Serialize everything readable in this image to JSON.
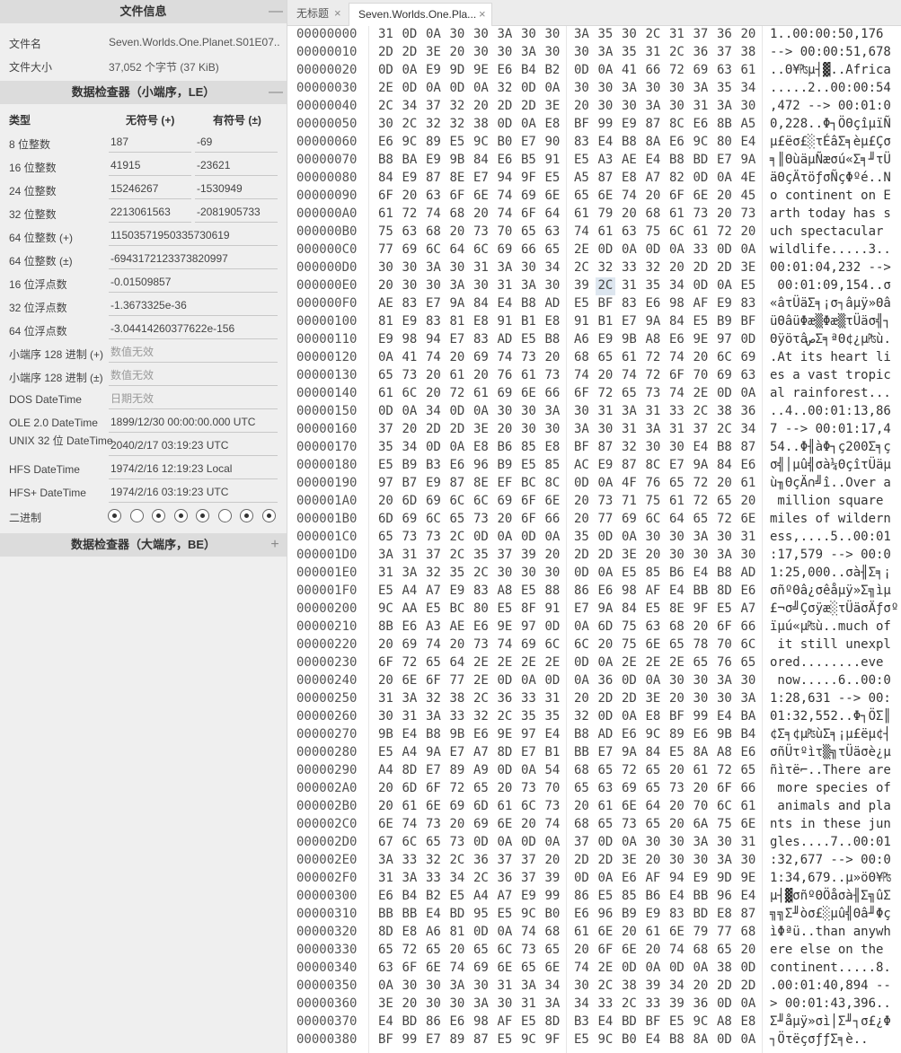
{
  "file_info": {
    "title": "文件信息",
    "toggle": "—",
    "rows": [
      {
        "label": "文件名",
        "value": "Seven.Worlds.One.Planet.S01E07..."
      },
      {
        "label": "文件大小",
        "value": "37,052 个字节 (37 KiB)"
      }
    ]
  },
  "inspector_le": {
    "title": "数据检查器（小端序，LE）",
    "toggle": "—",
    "col_type": "类型",
    "col_unsigned": "无符号 (+)",
    "col_signed": "有符号 (±)",
    "rows_pair": [
      {
        "label": "8 位整数",
        "u": "187",
        "s": "-69"
      },
      {
        "label": "16 位整数",
        "u": "41915",
        "s": "-23621"
      },
      {
        "label": "24 位整数",
        "u": "15246267",
        "s": "-1530949"
      },
      {
        "label": "32 位整数",
        "u": "2213061563",
        "s": "-2081905733"
      }
    ],
    "rows_wide": [
      {
        "label": "64 位整数 (+)",
        "value": "11503571950335730619",
        "invalid": false
      },
      {
        "label": "64 位整数 (±)",
        "value": "-6943172123373820997",
        "invalid": false
      },
      {
        "label": "16 位浮点数",
        "value": "-0.01509857",
        "invalid": false
      },
      {
        "label": "32 位浮点数",
        "value": "-1.3673325e-36",
        "invalid": false
      },
      {
        "label": "64 位浮点数",
        "value": "-3.04414260377622e-156",
        "invalid": false
      },
      {
        "label": "小端序 128 进制 (+)",
        "value": "数值无效",
        "invalid": true
      },
      {
        "label": "小端序 128 进制 (±)",
        "value": "数值无效",
        "invalid": true
      },
      {
        "label": "DOS DateTime",
        "value": "日期无效",
        "invalid": true
      },
      {
        "label": "OLE 2.0 DateTime",
        "value": "1899/12/30 00:00:00.000 UTC",
        "invalid": false
      },
      {
        "label": "UNIX 32 位 DateTime",
        "value": "2040/2/17 03:19:23 UTC",
        "invalid": false
      },
      {
        "label": "HFS DateTime",
        "value": "1974/2/16 12:19:23 Local",
        "invalid": false
      },
      {
        "label": "HFS+ DateTime",
        "value": "1974/2/16 03:19:23 UTC",
        "invalid": false
      }
    ],
    "binary_label": "二进制",
    "binary_bits": [
      1,
      0,
      1,
      1,
      1,
      0,
      1,
      1
    ]
  },
  "inspector_be": {
    "title": "数据检查器（大端序，BE）",
    "toggle": "+"
  },
  "tabs": [
    {
      "label": "无标题",
      "close": "×",
      "active": false
    },
    {
      "label": "Seven.Worlds.One.Pla...",
      "close": "×",
      "active": true
    }
  ],
  "hex_selected": {
    "row": 14,
    "col": 9
  },
  "hex_rows": [
    {
      "off": "00000000",
      "bytes": "31 0D 0A 30 30 3A 30 30 3A 35 30 2C 31 37 36 20",
      "ascii": "1..00:00:50,176 "
    },
    {
      "off": "00000010",
      "bytes": "2D 2D 3E 20 30 30 3A 30 30 3A 35 31 2C 36 37 38",
      "ascii": "--> 00:00:51,678"
    },
    {
      "off": "00000020",
      "bytes": "0D 0A E9 9D 9E E6 B4 B2 0D 0A 41 66 72 69 63 61",
      "ascii": "..Θ¥₧µ┤▓..Africa"
    },
    {
      "off": "00000030",
      "bytes": "2E 0D 0A 0D 0A 32 0D 0A 30 30 3A 30 30 3A 35 34",
      "ascii": ".....2..00:00:54"
    },
    {
      "off": "00000040",
      "bytes": "2C 34 37 32 20 2D 2D 3E 20 30 30 3A 30 31 3A 30",
      "ascii": ",472 --> 00:01:0"
    },
    {
      "off": "00000050",
      "bytes": "30 2C 32 32 38 0D 0A E8 BF 99 E9 87 8C E6 8B A5",
      "ascii": "0,228..Φ┐ÖΘçîµïÑ"
    },
    {
      "off": "00000060",
      "bytes": "E6 9C 89 E5 9C B0 E7 90 83 E4 B8 8A E6 9C 80 E4",
      "ascii": "µ£ëσ£░τÉâΣ╕èµ£Çσ"
    },
    {
      "off": "00000070",
      "bytes": "B8 BA E9 9B 84 E6 B5 91 E5 A3 AE E4 B8 BD E7 9A",
      "ascii": "╕║ΘùäµÑæσú«Σ╕╜τÜ"
    },
    {
      "off": "00000080",
      "bytes": "84 E9 87 8E E7 94 9F E5 A5 87 E8 A7 82 0D 0A 4E",
      "ascii": "äΘçÄτöƒσÑçΦºé..N"
    },
    {
      "off": "00000090",
      "bytes": "6F 20 63 6F 6E 74 69 6E 65 6E 74 20 6F 6E 20 45",
      "ascii": "o continent on E"
    },
    {
      "off": "000000A0",
      "bytes": "61 72 74 68 20 74 6F 64 61 79 20 68 61 73 20 73",
      "ascii": "arth today has s"
    },
    {
      "off": "000000B0",
      "bytes": "75 63 68 20 73 70 65 63 74 61 63 75 6C 61 72 20",
      "ascii": "uch spectacular "
    },
    {
      "off": "000000C0",
      "bytes": "77 69 6C 64 6C 69 66 65 2E 0D 0A 0D 0A 33 0D 0A",
      "ascii": "wildlife.....3.."
    },
    {
      "off": "000000D0",
      "bytes": "30 30 3A 30 31 3A 30 34 2C 32 33 32 20 2D 2D 3E",
      "ascii": "00:01:04,232 -->"
    },
    {
      "off": "000000E0",
      "bytes": "20 30 30 3A 30 31 3A 30 39 2C 31 35 34 0D 0A E5",
      "ascii": " 00:01:09,154..σ"
    },
    {
      "off": "000000F0",
      "bytes": "AE 83 E7 9A 84 E4 B8 AD E5 BF 83 E6 98 AF E9 83",
      "ascii": "«âτÜäΣ╕¡σ┐âµÿ»Θâ"
    },
    {
      "off": "00000100",
      "bytes": "81 E9 83 81 E8 91 B1 E8 91 B1 E7 9A 84 E5 B9 BF",
      "ascii": "üΘâüΦæ▒Φæ▒τÜäσ╣┐"
    },
    {
      "off": "00000110",
      "bytes": "E9 98 94 E7 83 AD E5 B8 A6 E9 9B A8 E6 9E 97 0D",
      "ascii": "ΘÿöτâصΣ╕ªΘ¢¿µ₧ù."
    },
    {
      "off": "00000120",
      "bytes": "0A 41 74 20 69 74 73 20 68 65 61 72 74 20 6C 69",
      "ascii": ".At its heart li"
    },
    {
      "off": "00000130",
      "bytes": "65 73 20 61 20 76 61 73 74 20 74 72 6F 70 69 63",
      "ascii": "es a vast tropic"
    },
    {
      "off": "00000140",
      "bytes": "61 6C 20 72 61 69 6E 66 6F 72 65 73 74 2E 0D 0A",
      "ascii": "al rainforest..."
    },
    {
      "off": "00000150",
      "bytes": "0D 0A 34 0D 0A 30 30 3A 30 31 3A 31 33 2C 38 36",
      "ascii": "..4..00:01:13,86"
    },
    {
      "off": "00000160",
      "bytes": "37 20 2D 2D 3E 20 30 30 3A 30 31 3A 31 37 2C 34",
      "ascii": "7 --> 00:01:17,4"
    },
    {
      "off": "00000170",
      "bytes": "35 34 0D 0A E8 B6 85 E8 BF 87 32 30 30 E4 B8 87",
      "ascii": "54..Φ╢àΦ┐ç200Σ╕ç"
    },
    {
      "off": "00000180",
      "bytes": "E5 B9 B3 E6 96 B9 E5 85 AC E9 87 8C E7 9A 84 E6",
      "ascii": "σ╣│µû╣σà¼ΘçîτÜäµ"
    },
    {
      "off": "00000190",
      "bytes": "97 B7 E9 87 8E EF BC 8C 0D 0A 4F 76 65 72 20 61",
      "ascii": "ù╖ΘçÄ∩╝î..Over a"
    },
    {
      "off": "000001A0",
      "bytes": "20 6D 69 6C 6C 69 6F 6E 20 73 71 75 61 72 65 20",
      "ascii": " million square "
    },
    {
      "off": "000001B0",
      "bytes": "6D 69 6C 65 73 20 6F 66 20 77 69 6C 64 65 72 6E",
      "ascii": "miles of wildern"
    },
    {
      "off": "000001C0",
      "bytes": "65 73 73 2C 0D 0A 0D 0A 35 0D 0A 30 30 3A 30 31",
      "ascii": "ess,....5..00:01"
    },
    {
      "off": "000001D0",
      "bytes": "3A 31 37 2C 35 37 39 20 2D 2D 3E 20 30 30 3A 30",
      "ascii": ":17,579 --> 00:0"
    },
    {
      "off": "000001E0",
      "bytes": "31 3A 32 35 2C 30 30 30 0D 0A E5 85 B6 E4 B8 AD",
      "ascii": "1:25,000..σà╢Σ╕¡"
    },
    {
      "off": "000001F0",
      "bytes": "E5 A4 A7 E9 83 A8 E5 88 86 E6 98 AF E4 BB 8D E6",
      "ascii": "σñºΘâ¿σêåµÿ»Σ╗ìµ"
    },
    {
      "off": "00000200",
      "bytes": "9C AA E5 BC 80 E5 8F 91 E7 9A 84 E5 8E 9F E5 A7",
      "ascii": "£¬σ╝Çσÿæ░τÜäσÄƒσº"
    },
    {
      "off": "00000210",
      "bytes": "8B E6 A3 AE E6 9E 97 0D 0A 6D 75 63 68 20 6F 66",
      "ascii": "ïµú«µ₧ù..much of"
    },
    {
      "off": "00000220",
      "bytes": "20 69 74 20 73 74 69 6C 6C 20 75 6E 65 78 70 6C",
      "ascii": " it still unexpl"
    },
    {
      "off": "00000230",
      "bytes": "6F 72 65 64 2E 2E 2E 2E 0D 0A 2E 2E 2E 65 76 65",
      "ascii": "ored........eve"
    },
    {
      "off": "00000240",
      "bytes": "20 6E 6F 77 2E 0D 0A 0D 0A 36 0D 0A 30 30 3A 30",
      "ascii": " now.....6..00:0"
    },
    {
      "off": "00000250",
      "bytes": "31 3A 32 38 2C 36 33 31 20 2D 2D 3E 20 30 30 3A",
      "ascii": "1:28,631 --> 00:"
    },
    {
      "off": "00000260",
      "bytes": "30 31 3A 33 32 2C 35 35 32 0D 0A E8 BF 99 E4 BA",
      "ascii": "01:32,552..Φ┐ÖΣ║"
    },
    {
      "off": "00000270",
      "bytes": "9B E4 B8 9B E6 9E 97 E4 B8 AD E6 9C 89 E6 9B B4",
      "ascii": "¢Σ╕¢µ₧ùΣ╕¡µ£ëµ¢┤"
    },
    {
      "off": "00000280",
      "bytes": "E5 A4 9A E7 A7 8D E7 B1 BB E7 9A 84 E5 8A A8 E6",
      "ascii": "σñÜτºìτ▒╗τÜäσè¿µ"
    },
    {
      "off": "00000290",
      "bytes": "A4 8D E7 89 A9 0D 0A 54 68 65 72 65 20 61 72 65",
      "ascii": "ñìτë⌐..There are"
    },
    {
      "off": "000002A0",
      "bytes": "20 6D 6F 72 65 20 73 70 65 63 69 65 73 20 6F 66",
      "ascii": " more species of"
    },
    {
      "off": "000002B0",
      "bytes": "20 61 6E 69 6D 61 6C 73 20 61 6E 64 20 70 6C 61",
      "ascii": " animals and pla"
    },
    {
      "off": "000002C0",
      "bytes": "6E 74 73 20 69 6E 20 74 68 65 73 65 20 6A 75 6E",
      "ascii": "nts in these jun"
    },
    {
      "off": "000002D0",
      "bytes": "67 6C 65 73 0D 0A 0D 0A 37 0D 0A 30 30 3A 30 31",
      "ascii": "gles....7..00:01"
    },
    {
      "off": "000002E0",
      "bytes": "3A 33 32 2C 36 37 37 20 2D 2D 3E 20 30 30 3A 30",
      "ascii": ":32,677 --> 00:0"
    },
    {
      "off": "000002F0",
      "bytes": "31 3A 33 34 2C 36 37 39 0D 0A E6 AF 94 E9 9D 9E",
      "ascii": "1:34,679..µ»öΘ¥₧"
    },
    {
      "off": "00000300",
      "bytes": "E6 B4 B2 E5 A4 A7 E9 99 86 E5 85 B6 E4 BB 96 E4",
      "ascii": "µ┤▓σñºΘÖåσà╢Σ╗ûΣ"
    },
    {
      "off": "00000310",
      "bytes": "BB BB E4 BD 95 E5 9C B0 E6 96 B9 E9 83 BD E8 87",
      "ascii": "╗╗Σ╜òσ£░µû╣Θâ╜Φç"
    },
    {
      "off": "00000320",
      "bytes": "8D E8 A6 81 0D 0A 74 68 61 6E 20 61 6E 79 77 68",
      "ascii": "ìΦªü..than anywh"
    },
    {
      "off": "00000330",
      "bytes": "65 72 65 20 65 6C 73 65 20 6F 6E 20 74 68 65 20",
      "ascii": "ere else on the "
    },
    {
      "off": "00000340",
      "bytes": "63 6F 6E 74 69 6E 65 6E 74 2E 0D 0A 0D 0A 38 0D",
      "ascii": "continent.....8."
    },
    {
      "off": "00000350",
      "bytes": "0A 30 30 3A 30 31 3A 34 30 2C 38 39 34 20 2D 2D",
      "ascii": ".00:01:40,894 --"
    },
    {
      "off": "00000360",
      "bytes": "3E 20 30 30 3A 30 31 3A 34 33 2C 33 39 36 0D 0A",
      "ascii": "> 00:01:43,396.."
    },
    {
      "off": "00000370",
      "bytes": "E4 BD 86 E6 98 AF E5 8D B3 E4 BD BF E5 9C A8 E8",
      "ascii": "Σ╜åµÿ»σì│Σ╜┐σ£¿Φ"
    },
    {
      "off": "00000380",
      "bytes": "BF 99 E7 89 87 E5 9C 9F E5 9C B0 E4 B8 8A 0D 0A",
      "ascii": "┐ÖτëçσƒƒΣ╕è.."
    }
  ]
}
